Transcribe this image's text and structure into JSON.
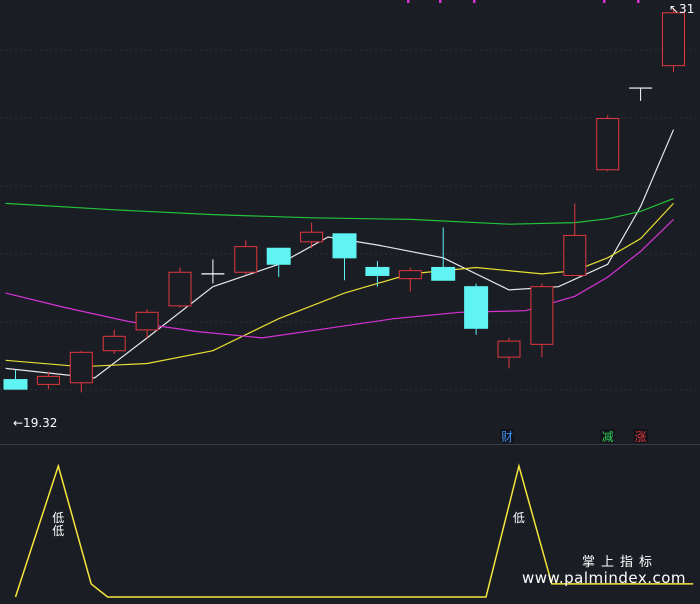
{
  "colors": {
    "background": "#1b1d24",
    "grid": "#2c2f3a",
    "up": "#e0383e",
    "down": "#5ff3f3",
    "doji": "#ffffff",
    "ma_fast": "#e8e8e8",
    "ma_mid": "#e6e033",
    "ma_slow": "#d633d6",
    "ma_long": "#22c33a",
    "indicator": "#f5e63b",
    "marker_top": "#d633d6"
  },
  "chart_data": [
    {
      "type": "candlestick",
      "ylim": [
        18.5,
        31.3
      ],
      "grid": true,
      "annotations": {
        "low_label": "19.32",
        "high_label": "31",
        "badges": [
          {
            "text": "财",
            "index": 15,
            "color": "#3d8ef0"
          },
          {
            "text": "减",
            "index": 18,
            "color": "#2ed15a"
          },
          {
            "text": "涨",
            "index": 19,
            "color": "#e0383e"
          }
        ]
      },
      "candles": [
        {
          "o": 19.7,
          "h": 20.0,
          "l": 19.7,
          "c": 19.4
        },
        {
          "o": 19.55,
          "h": 19.95,
          "l": 19.4,
          "c": 19.8
        },
        {
          "o": 19.6,
          "h": 20.6,
          "l": 19.3,
          "c": 20.55
        },
        {
          "o": 20.6,
          "h": 21.25,
          "l": 20.5,
          "c": 21.05
        },
        {
          "o": 21.25,
          "h": 21.9,
          "l": 21.0,
          "c": 21.8
        },
        {
          "o": 22.0,
          "h": 23.2,
          "l": 21.95,
          "c": 23.05
        },
        {
          "o": 23.0,
          "h": 23.45,
          "l": 22.7,
          "c": 23.0
        },
        {
          "o": 23.05,
          "h": 24.05,
          "l": 22.98,
          "c": 23.85
        },
        {
          "o": 23.8,
          "h": 23.8,
          "l": 22.9,
          "c": 23.3
        },
        {
          "o": 24.0,
          "h": 24.6,
          "l": 23.8,
          "c": 24.3
        },
        {
          "o": 24.25,
          "h": 24.25,
          "l": 22.8,
          "c": 23.5
        },
        {
          "o": 23.2,
          "h": 23.4,
          "l": 22.6,
          "c": 22.95
        },
        {
          "o": 22.85,
          "h": 23.2,
          "l": 22.45,
          "c": 23.1
        },
        {
          "o": 23.2,
          "h": 24.45,
          "l": 22.8,
          "c": 22.8
        },
        {
          "o": 22.6,
          "h": 22.7,
          "l": 21.1,
          "c": 21.3
        },
        {
          "o": 20.4,
          "h": 21.0,
          "l": 20.05,
          "c": 20.9
        },
        {
          "o": 20.8,
          "h": 22.7,
          "l": 20.4,
          "c": 22.6
        },
        {
          "o": 22.95,
          "h": 25.2,
          "l": 22.95,
          "c": 24.2
        },
        {
          "o": 26.25,
          "h": 27.95,
          "l": 26.2,
          "c": 27.85
        },
        {
          "o": 28.8,
          "h": 28.8,
          "l": 28.4,
          "c": 28.8
        },
        {
          "o": 29.5,
          "h": 31.3,
          "l": 29.3,
          "c": 31.15
        }
      ],
      "indicator_lines": [
        {
          "name": "MA-white",
          "color": "#e8e8e8",
          "x": [
            -0.3,
            2.4,
            4.0,
            6.0,
            8.0,
            9.5,
            11.0,
            13.0,
            15.0,
            16.5,
            18.0,
            19.0,
            20.0
          ],
          "y": [
            20.05,
            19.75,
            21.0,
            22.6,
            23.3,
            24.15,
            23.9,
            23.5,
            22.5,
            22.6,
            23.3,
            25.1,
            27.5
          ]
        },
        {
          "name": "MA-yellow",
          "color": "#e6e033",
          "x": [
            -0.3,
            2.0,
            4.0,
            6.0,
            8.0,
            10.0,
            12.0,
            14.0,
            16.0,
            17.0,
            18.0,
            19.0,
            20.0
          ],
          "y": [
            20.3,
            20.1,
            20.2,
            20.6,
            21.6,
            22.4,
            23.0,
            23.2,
            23.0,
            23.1,
            23.5,
            24.1,
            25.2
          ]
        },
        {
          "name": "MA-magenta",
          "color": "#d633d6",
          "x": [
            -0.3,
            1.5,
            3.5,
            5.5,
            7.5,
            9.5,
            11.5,
            13.5,
            15.5,
            17.0,
            18.0,
            19.0,
            20.0
          ],
          "y": [
            22.4,
            21.95,
            21.5,
            21.2,
            21.0,
            21.3,
            21.6,
            21.8,
            21.85,
            22.3,
            22.9,
            23.7,
            24.7
          ]
        },
        {
          "name": "MA-green",
          "color": "#22c33a",
          "x": [
            -0.3,
            3.0,
            6.0,
            9.0,
            12.0,
            15.0,
            17.0,
            18.0,
            19.0,
            20.0
          ],
          "y": [
            25.2,
            25.0,
            24.85,
            24.75,
            24.7,
            24.55,
            24.6,
            24.72,
            24.95,
            25.35
          ]
        }
      ]
    },
    {
      "type": "line",
      "color": "#f5e63b",
      "x": [
        0,
        1.3,
        2.3,
        2.8,
        14.3,
        15.3,
        16.3,
        20.6
      ],
      "y": [
        0,
        1,
        0.1,
        0,
        0,
        1,
        0.1,
        0.1
      ],
      "ylim": [
        0,
        1
      ],
      "labels": [
        {
          "text": "低",
          "index": 1.3
        },
        {
          "text": "低",
          "index": 15.3
        }
      ]
    }
  ],
  "watermark": {
    "cn": "掌上指标",
    "url": "www.palmindex.com"
  }
}
